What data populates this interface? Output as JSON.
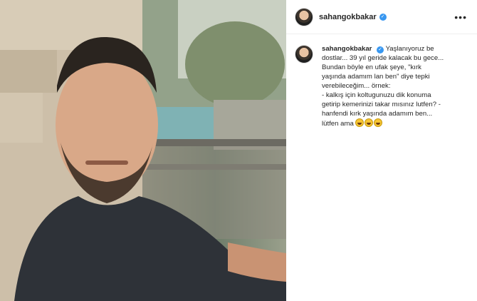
{
  "post": {
    "username": "sahangokbakar",
    "verified_icon": "verified-badge-icon",
    "more_icon": "more-options-icon",
    "caption_lines": [
      "Yaşlanıyoruz be",
      "dostlar... 39 yıl geride kalacak bu gece...",
      "Bundan böyle en ufak şeye, \"kırk",
      "yaşında adamım lan ben\" diye tepki",
      "verebileceğim... örnek:",
      "- kalkış için koltugunuzu dik konuma",
      "getirip kemerinizi takar mısınız lutfen? -",
      "hanfendi kırk yaşında adamım ben...",
      "lütfen ama"
    ],
    "caption_emojis": [
      "grinning-sweat-emoji",
      "grinning-sweat-emoji",
      "grinning-sweat-emoji"
    ]
  },
  "colors": {
    "verified": "#3897f0",
    "text": "#262626",
    "divider": "#efefef"
  }
}
